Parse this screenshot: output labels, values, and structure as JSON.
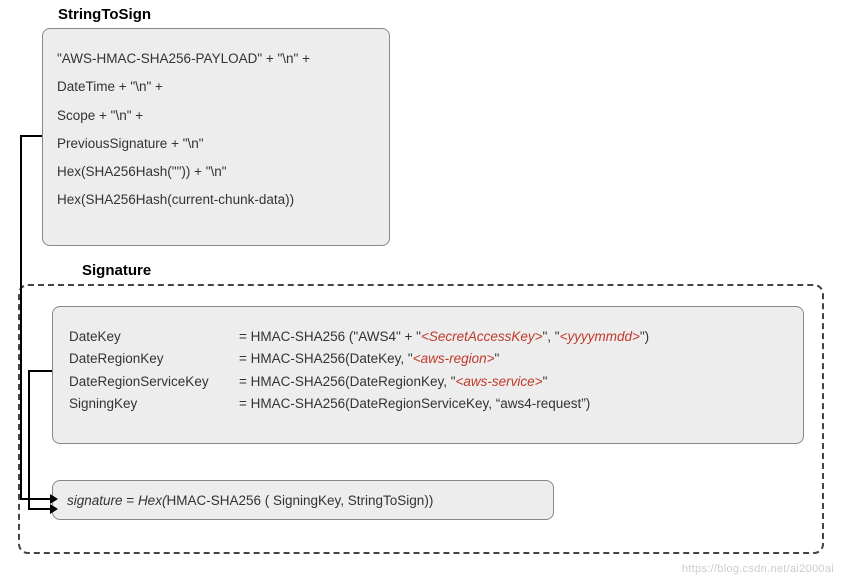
{
  "headings": {
    "stringToSign": "StringToSign",
    "signature": "Signature"
  },
  "stringToSign": {
    "line1": "\"AWS-HMAC-SHA256-PAYLOAD\" + \"\\n\" +",
    "line2": "DateTime + \"\\n\" +",
    "line3": "Scope + \"\\n\" +",
    "line4": "PreviousSignature + \"\\n\"",
    "line5": "Hex(SHA256Hash(\"\")) + \"\\n\"",
    "line6": "Hex(SHA256Hash(current-chunk-data))"
  },
  "keyDerivation": {
    "rows": [
      {
        "label": "DateKey",
        "pre": "= HMAC-SHA256 (\"AWS4\" + \"",
        "ph1": "<SecretAccessKey>",
        "mid": "\", \"",
        "ph2": "<yyyymmdd>",
        "post": "\")"
      },
      {
        "label": "DateRegionKey",
        "pre": "= HMAC-SHA256(DateKey, \"",
        "ph1": "<aws-region>",
        "mid": "",
        "ph2": "",
        "post": "\""
      },
      {
        "label": "DateRegionServiceKey",
        "pre": "= HMAC-SHA256(DateRegionKey, \"",
        "ph1": "<aws-service>",
        "mid": "",
        "ph2": "",
        "post": "\""
      },
      {
        "label": "SigningKey",
        "pre": "= HMAC-SHA256(DateRegionServiceKey, “aws4-request”)",
        "ph1": "",
        "mid": "",
        "ph2": "",
        "post": ""
      }
    ]
  },
  "signatureResult": {
    "var": "signature",
    "eq": " =   ",
    "hex": "Hex(",
    "fn": "HMAC-SHA256 ( SigningKey, StringToSign))"
  },
  "watermark": "https://blog.csdn.net/ai2000ai"
}
